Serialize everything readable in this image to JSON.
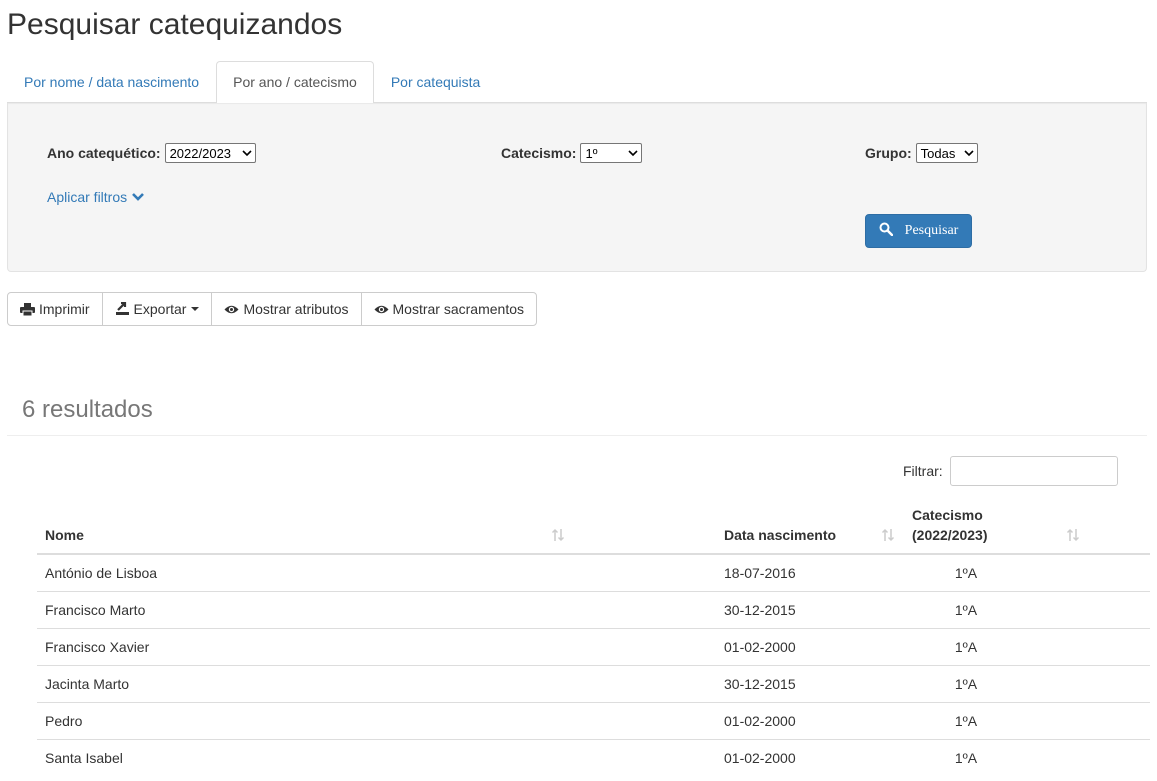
{
  "page": {
    "title": "Pesquisar catequizandos"
  },
  "tabs": [
    {
      "label": "Por nome / data nascimento",
      "active": false
    },
    {
      "label": "Por ano / catecismo",
      "active": true
    },
    {
      "label": "Por catequista",
      "active": false
    }
  ],
  "filters": {
    "ano": {
      "label": "Ano catequético:",
      "value": "2022/2023"
    },
    "catecismo": {
      "label": "Catecismo:",
      "value": "1º"
    },
    "grupo": {
      "label": "Grupo:",
      "value": "Todas"
    },
    "apply_label": "Aplicar filtros",
    "search_button": "Pesquisar"
  },
  "toolbar": {
    "print": "Imprimir",
    "export": "Exportar",
    "show_attributes": "Mostrar atributos",
    "show_sacraments": "Mostrar sacramentos"
  },
  "results": {
    "count_label": "6 resultados",
    "filter_label": "Filtrar:",
    "filter_value": ""
  },
  "table": {
    "headers": {
      "nome": "Nome",
      "data": "Data nascimento",
      "catecismo_line1": "Catecismo",
      "catecismo_line2": "(2022/2023)"
    },
    "rows": [
      {
        "nome": "António de Lisboa",
        "data": "18-07-2016",
        "catecismo": "1ºA"
      },
      {
        "nome": "Francisco Marto",
        "data": "30-12-2015",
        "catecismo": "1ºA"
      },
      {
        "nome": "Francisco Xavier",
        "data": "01-02-2000",
        "catecismo": "1ºA"
      },
      {
        "nome": "Jacinta Marto",
        "data": "30-12-2015",
        "catecismo": "1ºA"
      },
      {
        "nome": "Pedro",
        "data": "01-02-2000",
        "catecismo": "1ºA"
      },
      {
        "nome": "Santa Isabel",
        "data": "01-02-2000",
        "catecismo": "1ºA"
      }
    ]
  },
  "colors": {
    "link": "#337ab7",
    "primary": "#337ab7",
    "panel_bg": "#f5f5f5",
    "muted": "#777777"
  },
  "icons": [
    "chevron-down-icon",
    "search-icon",
    "print-icon",
    "export-icon",
    "eye-icon",
    "sort-icon"
  ]
}
